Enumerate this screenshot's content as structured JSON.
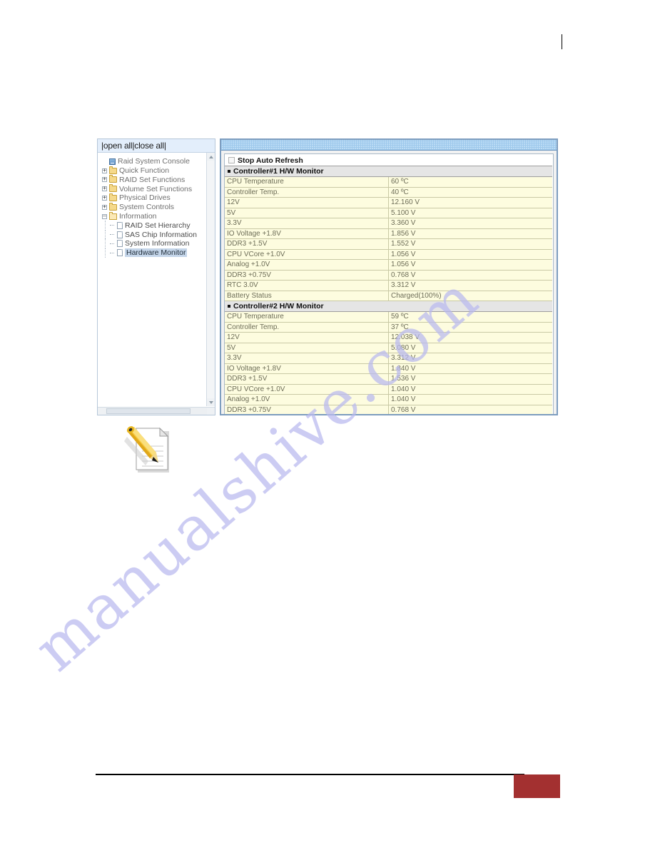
{
  "sidebar": {
    "header_links": "|open all|close all|",
    "tree": [
      {
        "label": "Raid System Console",
        "icon": "console-icon",
        "level": 0,
        "expander": "none",
        "selected": false
      },
      {
        "label": "Quick Function",
        "icon": "folder-icon",
        "level": 0,
        "expander": "plus",
        "selected": false
      },
      {
        "label": "RAID Set Functions",
        "icon": "folder-icon",
        "level": 0,
        "expander": "plus",
        "selected": false
      },
      {
        "label": "Volume Set Functions",
        "icon": "folder-icon",
        "level": 0,
        "expander": "plus",
        "selected": false
      },
      {
        "label": "Physical Drives",
        "icon": "folder-icon",
        "level": 0,
        "expander": "plus",
        "selected": false
      },
      {
        "label": "System Controls",
        "icon": "folder-icon",
        "level": 0,
        "expander": "plus",
        "selected": false
      },
      {
        "label": "Information",
        "icon": "folder-open-icon",
        "level": 0,
        "expander": "minus",
        "selected": false
      },
      {
        "label": "RAID Set Hierarchy",
        "icon": "page-icon",
        "level": 1,
        "expander": "dash",
        "selected": false
      },
      {
        "label": "SAS Chip Information",
        "icon": "page-icon",
        "level": 1,
        "expander": "dash",
        "selected": false
      },
      {
        "label": "System Information",
        "icon": "page-icon",
        "level": 1,
        "expander": "dash",
        "selected": false
      },
      {
        "label": "Hardware Monitor",
        "icon": "page-icon",
        "level": 1,
        "expander": "dash",
        "selected": true
      }
    ]
  },
  "content": {
    "stop_auto_refresh_label": "Stop Auto Refresh",
    "stop_auto_refresh_checked": false,
    "sections": [
      {
        "title": "Controller#1 H/W Monitor",
        "rows": [
          {
            "key": "CPU Temperature",
            "value": "60 ºC"
          },
          {
            "key": "Controller Temp.",
            "value": "40 ºC"
          },
          {
            "key": "12V",
            "value": "12.160 V"
          },
          {
            "key": "5V",
            "value": "5.100 V"
          },
          {
            "key": "3.3V",
            "value": "3.360 V"
          },
          {
            "key": "IO Voltage +1.8V",
            "value": "1.856 V"
          },
          {
            "key": "DDR3 +1.5V",
            "value": "1.552 V"
          },
          {
            "key": "CPU VCore +1.0V",
            "value": "1.056 V"
          },
          {
            "key": "Analog +1.0V",
            "value": "1.056 V"
          },
          {
            "key": "DDR3 +0.75V",
            "value": "0.768 V"
          },
          {
            "key": "RTC 3.0V",
            "value": "3.312 V"
          },
          {
            "key": "Battery Status",
            "value": "Charged(100%)"
          }
        ]
      },
      {
        "title": "Controller#2 H/W Monitor",
        "rows": [
          {
            "key": "CPU Temperature",
            "value": "59 ºC"
          },
          {
            "key": "Controller Temp.",
            "value": "37 ºC"
          },
          {
            "key": "12V",
            "value": "12.038 V"
          },
          {
            "key": "5V",
            "value": "5.080 V"
          },
          {
            "key": "3.3V",
            "value": "3.312 V"
          },
          {
            "key": "IO Voltage +1.8V",
            "value": "1.840 V"
          },
          {
            "key": "DDR3 +1.5V",
            "value": "1.536 V"
          },
          {
            "key": "CPU VCore +1.0V",
            "value": "1.040 V"
          },
          {
            "key": "Analog +1.0V",
            "value": "1.040 V"
          },
          {
            "key": "DDR3 +0.75V",
            "value": "0.768 V"
          }
        ]
      }
    ]
  },
  "page": {
    "watermark_text": "manualshive.com",
    "note_icon_name": "note-pencil-icon",
    "accent_color": "#a33030",
    "blue_bar_color": "#bcdcf5",
    "table_row_color": "#fdfcdf",
    "section_header_color": "#e5e5e5"
  }
}
